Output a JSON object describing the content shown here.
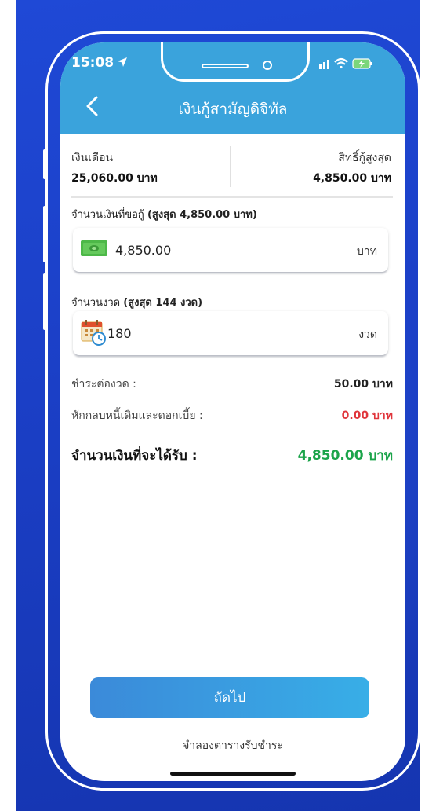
{
  "status_bar": {
    "time": "15:08"
  },
  "header": {
    "title": "เงินกู้สามัญดิจิทัล"
  },
  "info": {
    "salary_label": "เงินเดือน",
    "salary_value": "25,060.00 บาท",
    "max_label": "สิทธิ์กู้สูงสุด",
    "max_value": "4,850.00 บาท"
  },
  "loan_amount": {
    "label": "จำนวนเงินที่ขอกู้",
    "limit": "(สูงสุด 4,850.00 บาท)",
    "value": "4,850.00",
    "unit": "บาท"
  },
  "installments": {
    "label": "จำนวนงวด",
    "limit": "(สูงสุด 144 งวด)",
    "value": "180",
    "unit": "งวด"
  },
  "summary": {
    "per_installment_label": "ชำระต่องวด :",
    "per_installment_value": "50.00 บาท",
    "deduction_label": "หักกลบหนี้เดิมและดอกเบี้ย :",
    "deduction_value": "0.00 บาท",
    "total_label": "จำนวนเงินที่จะได้รับ :",
    "total_value": "4,850.00 บาท"
  },
  "actions": {
    "next": "ถัดไป",
    "schedule": "จำลองตารางรับชำระ"
  },
  "colors": {
    "header": "#3aa3dc",
    "background": "#1b3fc6",
    "total": "#1ba44a",
    "deduction": "#e0353b"
  }
}
